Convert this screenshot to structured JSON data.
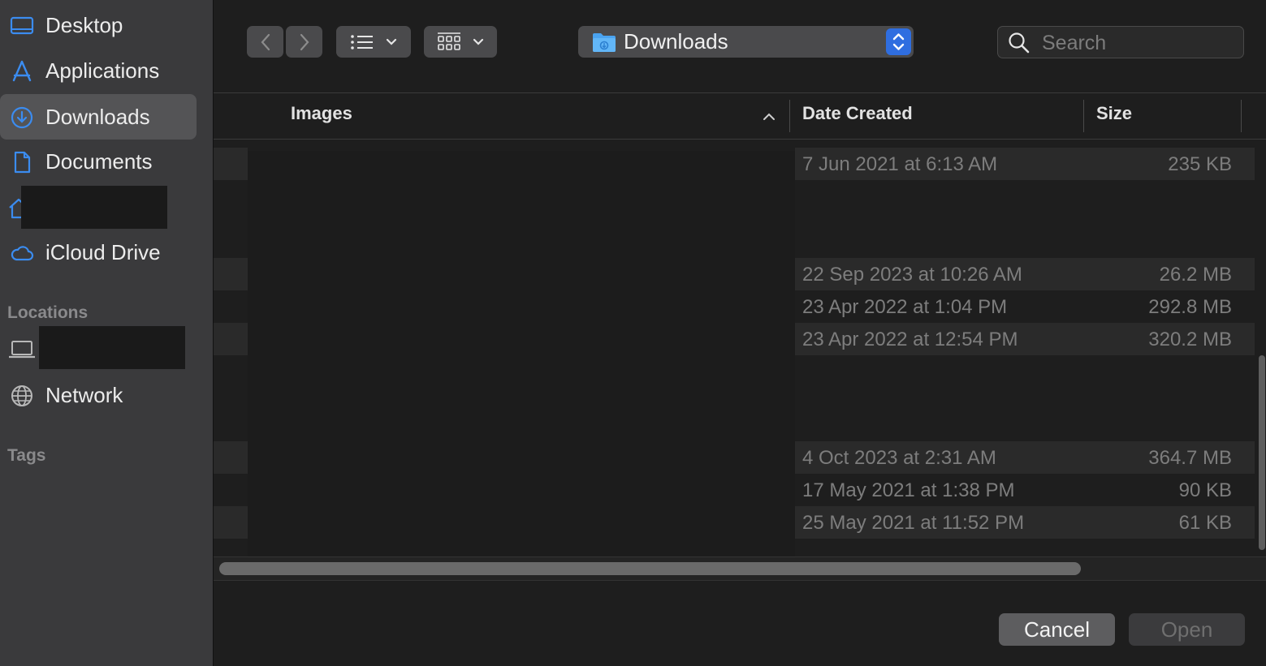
{
  "sidebar": {
    "favorites": [
      {
        "label": "Desktop",
        "icon": "desktop-icon"
      },
      {
        "label": "Applications",
        "icon": "applications-icon"
      },
      {
        "label": "Downloads",
        "icon": "downloads-icon",
        "selected": true
      },
      {
        "label": "Documents",
        "icon": "document-icon"
      },
      {
        "label": "",
        "icon": "home-icon",
        "redacted": true
      },
      {
        "label": "iCloud Drive",
        "icon": "cloud-icon"
      }
    ],
    "locations_title": "Locations",
    "locations": [
      {
        "label": "",
        "icon": "laptop-icon",
        "redacted": true
      },
      {
        "label": "Network",
        "icon": "network-globe-icon"
      }
    ],
    "tags_title": "Tags"
  },
  "toolbar": {
    "location_popup": {
      "label": "Downloads",
      "icon": "folder-icon"
    },
    "search_placeholder": "Search"
  },
  "columns": {
    "name": "Images",
    "date": "Date Created",
    "size": "Size"
  },
  "rows": [
    {
      "date": "7 Jun 2021 at 6:13 AM",
      "size": "235 KB"
    },
    {
      "date": "22 Sep 2023 at 10:26 AM",
      "size": "26.2 MB"
    },
    {
      "date": "23 Apr 2022 at 1:04 PM",
      "size": "292.8 MB"
    },
    {
      "date": "23 Apr 2022 at 12:54 PM",
      "size": "320.2 MB"
    },
    {
      "date": "4 Oct 2023 at 2:31 AM",
      "size": "364.7 MB"
    },
    {
      "date": "17 May 2021 at 1:38 PM",
      "size": "90 KB"
    },
    {
      "date": "25 May 2021 at 11:52 PM",
      "size": "61 KB"
    }
  ],
  "footer": {
    "cancel": "Cancel",
    "open": "Open"
  },
  "colors": {
    "accent": "#2f6ee0",
    "sidebar_icon": "#3b8cf0",
    "background": "#1e1e1e",
    "sidebar": "#3a3a3c"
  }
}
